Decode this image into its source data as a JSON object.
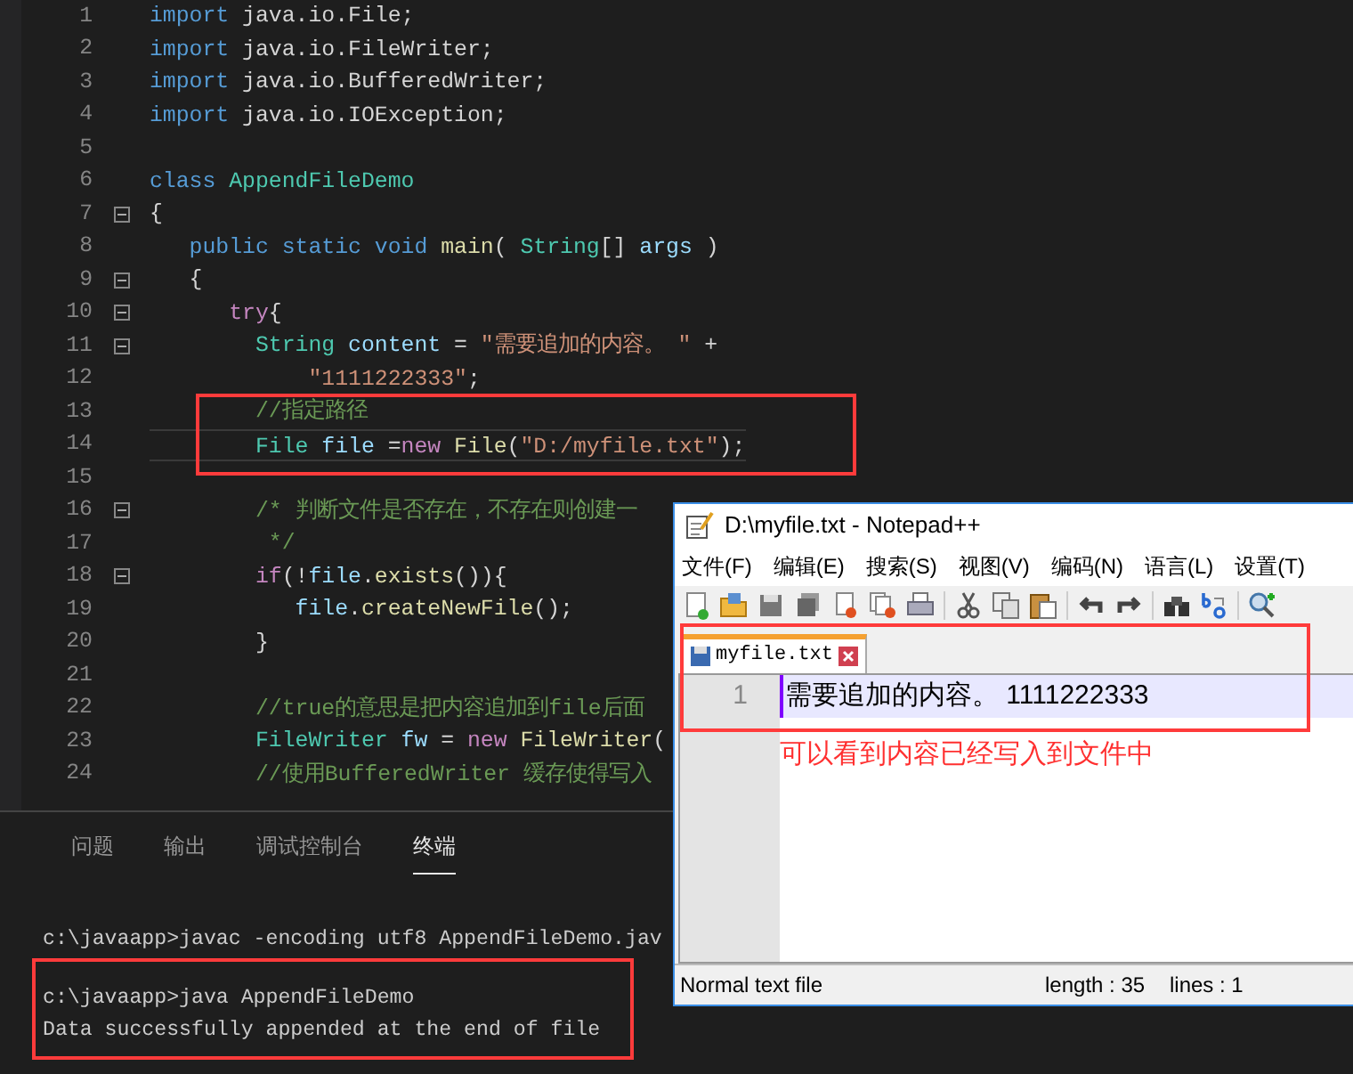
{
  "editor": {
    "lines": [
      {
        "number": "1",
        "fold": false,
        "current": false,
        "tokens": [
          {
            "kind": "keyword",
            "text": "import"
          },
          {
            "kind": "plain",
            "text": " java.io.File;"
          }
        ]
      },
      {
        "number": "2",
        "fold": false,
        "current": false,
        "tokens": [
          {
            "kind": "keyword",
            "text": "import"
          },
          {
            "kind": "plain",
            "text": " java.io.FileWriter;"
          }
        ]
      },
      {
        "number": "3",
        "fold": false,
        "current": false,
        "tokens": [
          {
            "kind": "keyword",
            "text": "import"
          },
          {
            "kind": "plain",
            "text": " java.io.BufferedWriter;"
          }
        ]
      },
      {
        "number": "4",
        "fold": false,
        "current": false,
        "tokens": [
          {
            "kind": "keyword",
            "text": "import"
          },
          {
            "kind": "plain",
            "text": " java.io.IOException;"
          }
        ]
      },
      {
        "number": "5",
        "fold": false,
        "current": false
      },
      {
        "number": "6",
        "fold": false,
        "current": false,
        "tokens": [
          {
            "kind": "keyword",
            "text": "class "
          },
          {
            "kind": "type",
            "text": "AppendFileDemo"
          }
        ]
      },
      {
        "number": "7",
        "fold": true,
        "current": false,
        "tokens": [
          {
            "kind": "plain",
            "text": "{"
          }
        ]
      },
      {
        "number": "8",
        "fold": false,
        "current": false,
        "tokens": [
          {
            "kind": "keyword",
            "text": "   public static void "
          },
          {
            "kind": "func",
            "text": "main"
          },
          {
            "kind": "plain",
            "text": "( "
          },
          {
            "kind": "type",
            "text": "String"
          },
          {
            "kind": "plain",
            "text": "[] "
          },
          {
            "kind": "ident",
            "text": "args"
          },
          {
            "kind": "plain",
            "text": " )"
          }
        ]
      },
      {
        "number": "9",
        "fold": true,
        "current": false,
        "tokens": [
          {
            "kind": "plain",
            "text": "   {"
          }
        ]
      },
      {
        "number": "10",
        "fold": true,
        "current": false,
        "tokens": [
          {
            "kind": "control",
            "text": "      try"
          },
          {
            "kind": "plain",
            "text": "{"
          }
        ]
      },
      {
        "number": "11",
        "fold": true,
        "current": false,
        "tokens": [
          {
            "kind": "type",
            "text": "        String "
          },
          {
            "kind": "ident",
            "text": "content"
          },
          {
            "kind": "plain",
            "text": " = "
          },
          {
            "kind": "string",
            "text": "\"需要追加的内容。 \""
          },
          {
            "kind": "plain",
            "text": " +"
          }
        ]
      },
      {
        "number": "12",
        "fold": false,
        "current": false,
        "tokens": [
          {
            "kind": "string",
            "text": "            \"1111222333\""
          },
          {
            "kind": "plain",
            "text": ";"
          }
        ]
      },
      {
        "number": "13",
        "fold": false,
        "current": false,
        "tokens": [
          {
            "kind": "comment",
            "text": "        //指定路径"
          }
        ]
      },
      {
        "number": "14",
        "fold": false,
        "current": true,
        "tokens": [
          {
            "kind": "type",
            "text": "        File "
          },
          {
            "kind": "ident",
            "text": "file"
          },
          {
            "kind": "plain",
            "text": " ="
          },
          {
            "kind": "control",
            "text": "new "
          },
          {
            "kind": "func",
            "text": "File"
          },
          {
            "kind": "plain",
            "text": "("
          },
          {
            "kind": "string",
            "text": "\"D:/myfile.txt\""
          },
          {
            "kind": "plain",
            "text": ");"
          }
        ]
      },
      {
        "number": "15",
        "fold": false,
        "current": false
      },
      {
        "number": "16",
        "fold": true,
        "current": false,
        "tokens": [
          {
            "kind": "comment",
            "text": "        /* 判断文件是否存在，不存在则创建一"
          }
        ]
      },
      {
        "number": "17",
        "fold": false,
        "current": false,
        "tokens": [
          {
            "kind": "comment",
            "text": "         */"
          }
        ]
      },
      {
        "number": "18",
        "fold": true,
        "current": false,
        "tokens": [
          {
            "kind": "control",
            "text": "        if"
          },
          {
            "kind": "plain",
            "text": "(!"
          },
          {
            "kind": "ident",
            "text": "file"
          },
          {
            "kind": "plain",
            "text": "."
          },
          {
            "kind": "func",
            "text": "exists"
          },
          {
            "kind": "plain",
            "text": "()){"
          }
        ]
      },
      {
        "number": "19",
        "fold": false,
        "current": false,
        "tokens": [
          {
            "kind": "ident",
            "text": "           file"
          },
          {
            "kind": "plain",
            "text": "."
          },
          {
            "kind": "func",
            "text": "createNewFile"
          },
          {
            "kind": "plain",
            "text": "();"
          }
        ]
      },
      {
        "number": "20",
        "fold": false,
        "current": false,
        "tokens": [
          {
            "kind": "plain",
            "text": "        }"
          }
        ]
      },
      {
        "number": "21",
        "fold": false,
        "current": false
      },
      {
        "number": "22",
        "fold": false,
        "current": false,
        "tokens": [
          {
            "kind": "comment",
            "text": "        //true的意思是把内容追加到file后面"
          }
        ]
      },
      {
        "number": "23",
        "fold": false,
        "current": false,
        "tokens": [
          {
            "kind": "type",
            "text": "        FileWriter "
          },
          {
            "kind": "ident",
            "text": "fw"
          },
          {
            "kind": "plain",
            "text": " = "
          },
          {
            "kind": "control",
            "text": "new "
          },
          {
            "kind": "func",
            "text": "FileWriter"
          },
          {
            "kind": "plain",
            "text": "("
          }
        ]
      },
      {
        "number": "24",
        "fold": false,
        "current": false,
        "tokens": [
          {
            "kind": "comment",
            "text": "        //使用BufferedWriter 缓存使得写入"
          }
        ]
      }
    ]
  },
  "panel": {
    "tabs": [
      {
        "label": "问题",
        "selected": false
      },
      {
        "label": "输出",
        "selected": false
      },
      {
        "label": "调试控制台",
        "selected": false
      },
      {
        "label": "终端",
        "selected": true
      }
    ],
    "terminal": [
      "c:\\javaapp>javac -encoding utf8 AppendFileDemo.jav",
      "c:\\javaapp>java AppendFileDemo",
      "Data successfully appended at the end of file"
    ]
  },
  "notepad": {
    "title": "D:\\myfile.txt - Notepad++",
    "menu": [
      "文件(F)",
      "编辑(E)",
      "搜索(S)",
      "视图(V)",
      "编码(N)",
      "语言(L)",
      "设置(T)"
    ],
    "tab": {
      "label": "myfile.txt",
      "selected": true
    },
    "lines": [
      {
        "number": "1",
        "text": "需要追加的内容。 1111222333"
      }
    ],
    "status": {
      "type": "Normal text file",
      "length": "length : 35",
      "lines": "lines : 1"
    }
  },
  "annotation": "可以看到内容已经写入到文件中"
}
